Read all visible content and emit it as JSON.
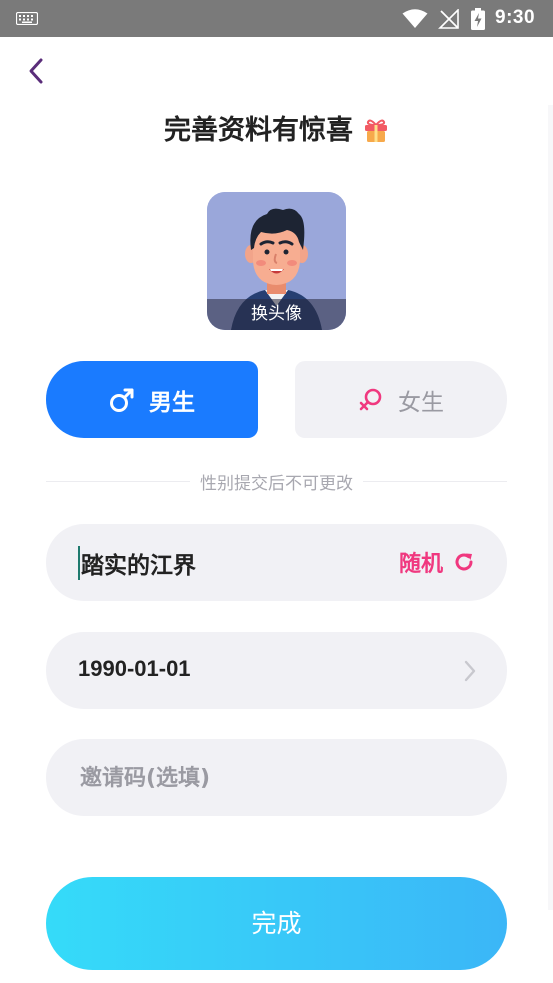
{
  "status_bar": {
    "time": "9:30",
    "icons": [
      "keyboard-icon",
      "wifi-icon",
      "no-signal-icon",
      "battery-charging-icon"
    ]
  },
  "header": {
    "title": "完善资料有惊喜",
    "title_icon": "gift-icon",
    "back_icon": "chevron-left-icon"
  },
  "avatar": {
    "change_label": "换头像",
    "background": "#9aa7da"
  },
  "gender": {
    "male_label": "男生",
    "female_label": "女生",
    "selected": "male",
    "male_color": "#1a7bff",
    "female_icon_color": "#f0387f",
    "hint": "性别提交后不可更改"
  },
  "form": {
    "nickname_value": "踏实的江界",
    "random_label": "随机",
    "birthday_value": "1990-01-01",
    "invite_placeholder": "邀请码(选填)",
    "invite_value": ""
  },
  "submit": {
    "label": "完成",
    "gradient_start": "#35dbf9",
    "gradient_end": "#3bb6f7"
  }
}
